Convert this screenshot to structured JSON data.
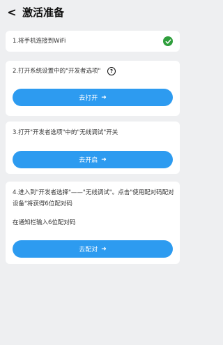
{
  "header": {
    "back_icon": "back-arrow-icon",
    "title": "激活准备"
  },
  "steps": [
    {
      "text": "1.将手机连接到WiFi",
      "status_icon": "check-circle-icon",
      "status_color": "#2f9e3c"
    },
    {
      "text": "2.打开系统设置中的\"开发者选项\"",
      "help_icon": "question-circle-icon",
      "button_label": "去打开",
      "button_icon": "arrow-right-icon"
    },
    {
      "text": "3.打开\"开发者选项\"中的\"无线调试\"开关",
      "button_label": "去开启",
      "button_icon": "arrow-right-icon"
    },
    {
      "text": "4.进入到\"开发者选择\"——\"无线调试\"。点击\"使用配对码配对设备\"将获得6位配对码",
      "hint": "在通知栏输入6位配对码",
      "button_label": "去配对",
      "button_icon": "arrow-right-icon"
    }
  ],
  "colors": {
    "accent": "#2d9bf0",
    "background": "#eeeff1",
    "success": "#2f9e3c"
  }
}
